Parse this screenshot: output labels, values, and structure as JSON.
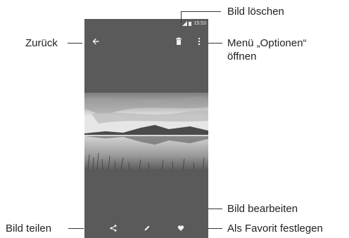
{
  "status_bar": {
    "time": "15:53"
  },
  "callouts": {
    "delete": "Bild löschen",
    "back": "Zurück",
    "options_line1": "Menü „Optionen“",
    "options_line2": "öffnen",
    "edit": "Bild bearbeiten",
    "share": "Bild teilen",
    "favorite": "Als Favorit festlegen"
  },
  "icons": {
    "back": "back-arrow-icon",
    "delete": "trash-icon",
    "options": "more-vert-icon",
    "share": "share-icon",
    "edit": "pencil-icon",
    "favorite": "heart-icon"
  },
  "colors": {
    "screen_bg": "#5a5a5a",
    "icon": "#f0f0f0",
    "text": "#222222"
  }
}
